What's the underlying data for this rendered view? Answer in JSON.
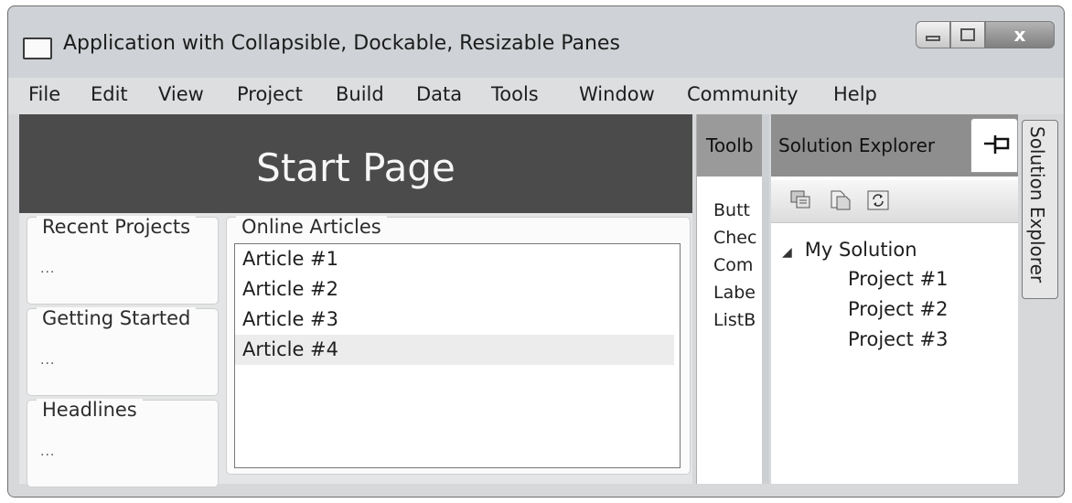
{
  "window": {
    "title": "Application with Collapsible, Dockable, Resizable Panes",
    "close_glyph": "x"
  },
  "menu": [
    "File",
    "Edit",
    "View",
    "Project",
    "Build",
    "Data",
    "Tools",
    "Window",
    "Community",
    "Help"
  ],
  "start_page": {
    "title": "Start Page",
    "groups": [
      {
        "label": "Recent Projects",
        "text": "..."
      },
      {
        "label": "Getting Started",
        "text": "..."
      },
      {
        "label": "Headlines",
        "text": "..."
      }
    ],
    "online_articles": {
      "label": "Online Articles",
      "items": [
        "Article #1",
        "Article #2",
        "Article #3",
        "Article #4"
      ],
      "selected": "Article #4"
    }
  },
  "toolbox": {
    "title": "Toolb",
    "items": [
      "Butt",
      "Chec",
      "Com",
      "Labe",
      "ListB"
    ]
  },
  "solution_explorer": {
    "title": "Solution Explorer",
    "root": "My Solution",
    "projects": [
      "Project #1",
      "Project #2",
      "Project #3"
    ],
    "side_tab": "Solution Explorer"
  }
}
